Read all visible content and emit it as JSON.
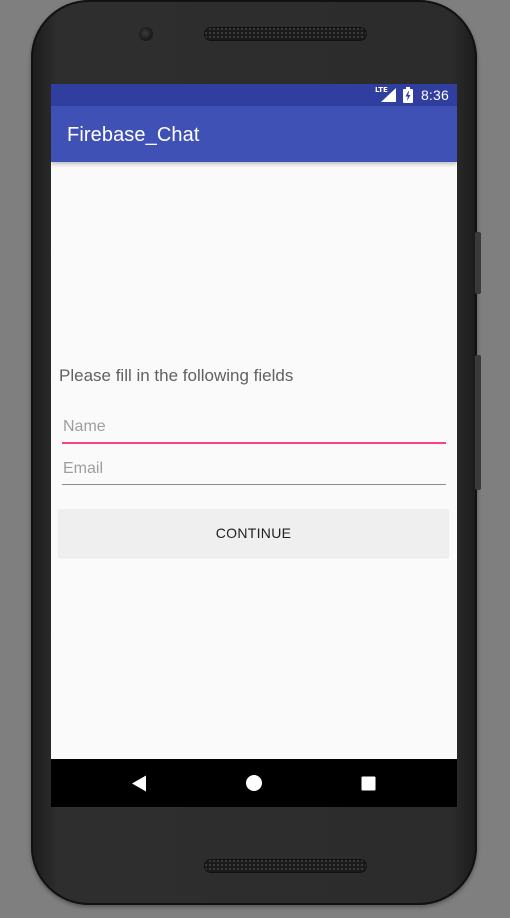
{
  "status_bar": {
    "network_label": "LTE",
    "time": "8:36",
    "icons": [
      "lte-signal-icon",
      "battery-charging-icon"
    ]
  },
  "app_bar": {
    "title": "Firebase_Chat"
  },
  "form": {
    "prompt": "Please fill in the following fields",
    "name_placeholder": "Name",
    "name_value": "",
    "email_placeholder": "Email",
    "email_value": "",
    "continue_label": "CONTINUE"
  },
  "nav_bar": {
    "icons": [
      "back-icon",
      "home-icon",
      "recents-icon"
    ]
  },
  "colors": {
    "status_bar": "#303f9f",
    "app_bar": "#3f51b5",
    "accent": "#ff4081",
    "background": "#fafafa",
    "button": "#efefef"
  }
}
